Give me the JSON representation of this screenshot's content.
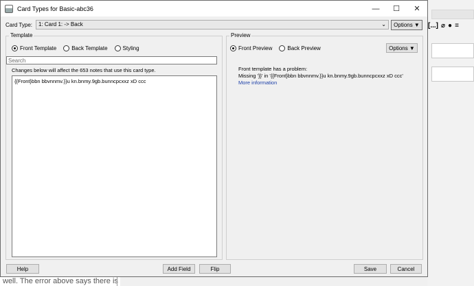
{
  "window": {
    "title": "Card Types for Basic-abc36",
    "minimize": "—",
    "maximize": "☐",
    "close": "✕"
  },
  "card_type": {
    "label": "Card Type:",
    "value": "1: Card 1:  -> Back",
    "options_button": "Options ▼"
  },
  "template": {
    "group_label": "Template",
    "radios": [
      {
        "label": "Front Template",
        "selected": true
      },
      {
        "label": "Back Template",
        "selected": false
      },
      {
        "label": "Styling",
        "selected": false
      }
    ],
    "search_placeholder": "Search",
    "info": "Changes below will affect the 653 notes that use this card type.",
    "editor_text": "{{Front}bbn bbvnnmv.}}u kn.bnmy.9gb.bunncpcxxz xD ccc"
  },
  "preview": {
    "group_label": "Preview",
    "radios": [
      {
        "label": "Front Preview",
        "selected": true
      },
      {
        "label": "Back Preview",
        "selected": false
      }
    ],
    "options_button": "Options ▼",
    "problem_title": "Front template has a problem:",
    "problem_detail": "Missing '}}' in '{{Front}bbn bbvnnmv.}}u kn.bnmy.9gb.bunncpcxxz xD ccc'",
    "more_info_link": "More information"
  },
  "buttons": {
    "help": "Help",
    "add_field": "Add Field",
    "flip": "Flip",
    "save": "Save",
    "cancel": "Cancel"
  },
  "background": {
    "toolbar_icons": [
      "[...]",
      "link-icon",
      "microphone-icon",
      "menu-icon"
    ],
    "toolbar_glyphs": [
      "[...]",
      "⌀",
      "●",
      "≡"
    ],
    "bottom_text": "well. The error above says there is"
  }
}
